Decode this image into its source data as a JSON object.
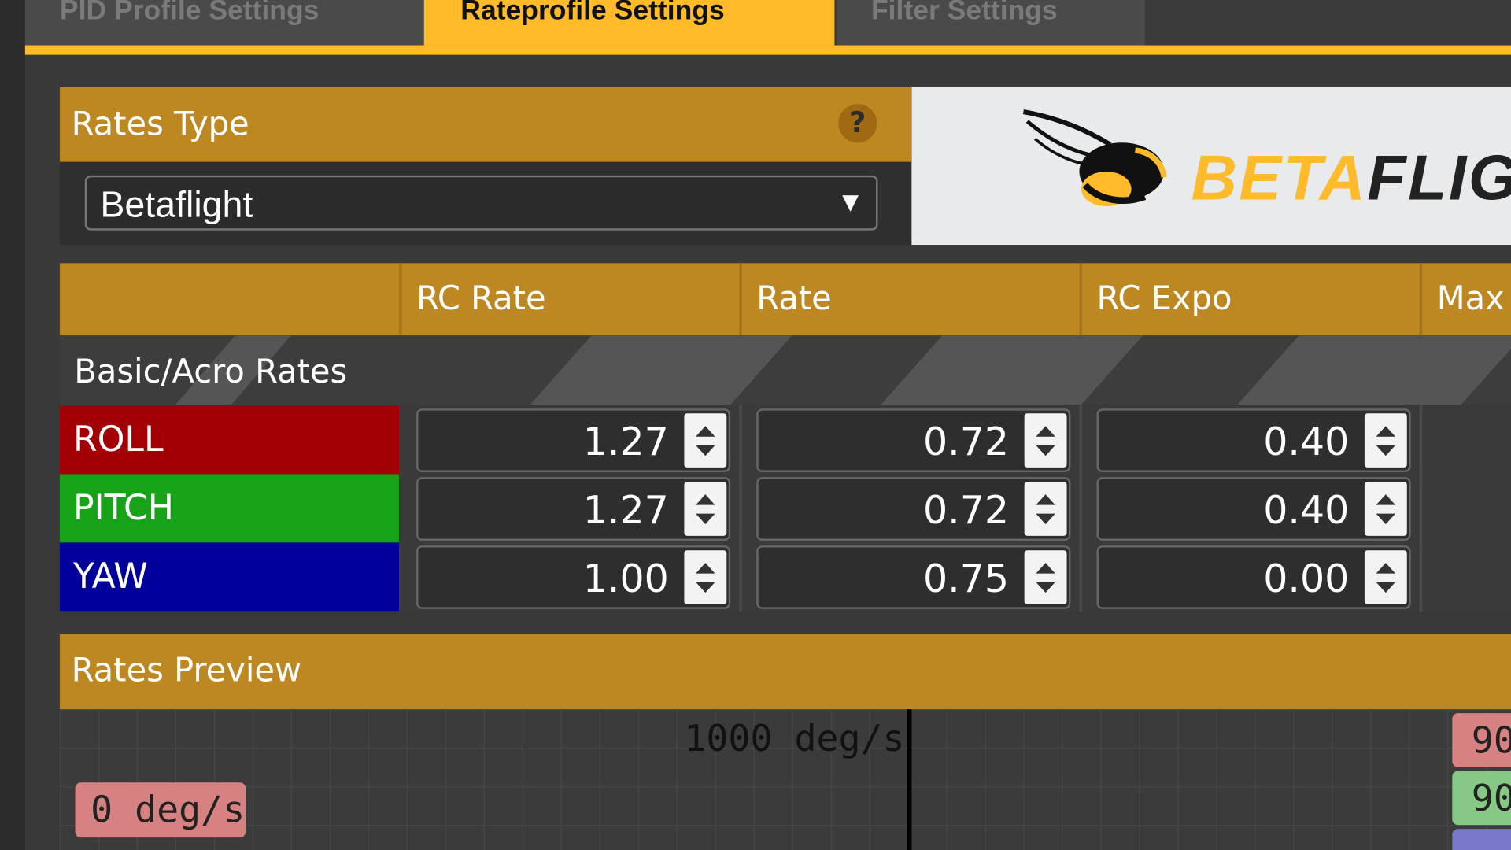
{
  "tabs": [
    {
      "label": "PID Profile Settings",
      "active": false
    },
    {
      "label": "Rateprofile Settings",
      "active": true
    },
    {
      "label": "Filter Settings",
      "active": false
    }
  ],
  "rates_type": {
    "header": "Rates Type",
    "help_icon": "question-circle-icon",
    "selected": "Betaflight"
  },
  "logo": {
    "text_a": "BETA",
    "text_b": "FLIG"
  },
  "table": {
    "columns": [
      "RC Rate",
      "Rate",
      "RC Expo",
      "Max"
    ],
    "section_label": "Basic/Acro Rates",
    "rows": [
      {
        "axis": "ROLL",
        "color": "#a30006",
        "rc_rate": "1.27",
        "rate": "0.72",
        "rc_expo": "0.40"
      },
      {
        "axis": "PITCH",
        "color": "#17a318",
        "rc_rate": "1.27",
        "rate": "0.72",
        "rc_expo": "0.40"
      },
      {
        "axis": "YAW",
        "color": "#01009a",
        "rc_rate": "1.00",
        "rate": "0.75",
        "rc_expo": "0.00"
      }
    ]
  },
  "preview": {
    "header": "Rates Preview",
    "top_label": "1000 deg/s",
    "zero_label": "0 deg/s",
    "right_badges": [
      "90",
      "90"
    ],
    "badge_colors": [
      "#d78282",
      "#86c886",
      "#7a78c9"
    ]
  },
  "colors": {
    "accent": "#ffbb29",
    "header_gold": "#bd8722"
  }
}
